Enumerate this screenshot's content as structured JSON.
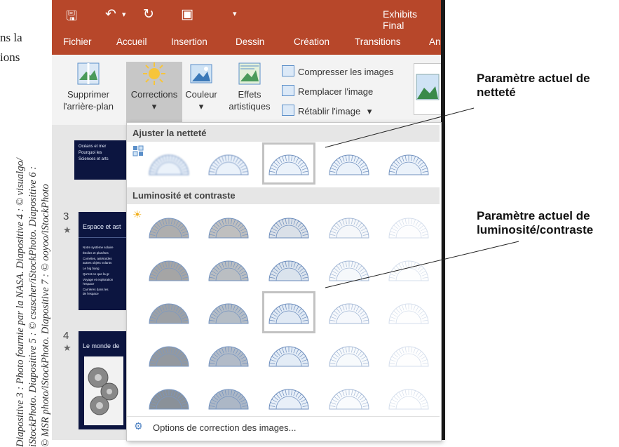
{
  "page": {
    "text_line1": "ns la",
    "text_line2": "ions",
    "credit_line1": "Diapositive 3 : Photo fournie par la NASA. Diapositive 4 : © visualgo/",
    "credit_line2": "iStockPhoto. Diapositive 5 : © csascher/iStockPhoto. Diapositive 6 :",
    "credit_line3": "© MSR photo/iStockPhoto. Diapositive 7 : © ooyoo/iStockPhoto"
  },
  "window": {
    "title": "Exhibits Final",
    "menu": [
      "Fichier",
      "Accueil",
      "Insertion",
      "Dessin",
      "Création",
      "Transitions",
      "Ani"
    ],
    "ribbon": {
      "remove_bg": "Supprimer l'arrière-plan",
      "corrections": "Corrections",
      "couleur": "Couleur",
      "effets": "Effets artistiques",
      "compress": "Compresser les images",
      "replace": "Remplacer l'image",
      "reset": "Rétablir l'image",
      "dropdown_arrow": "▾"
    },
    "slides": [
      {
        "number": "3",
        "star": "★",
        "title": "Espace et ast"
      },
      {
        "number": "4",
        "star": "★",
        "title": "Le monde de"
      }
    ],
    "slide2_bullets": [
      "Océans et mer",
      "Pourquoi les",
      "Sciences et arts"
    ],
    "slide3_bullets": [
      "Notre système solaire",
      "Étoiles et planètes",
      "Comètes, astéroïdes",
      "autres objets volants",
      "Le big bang",
      "Qu'est-ce que la gr",
      "Voyage et exploration",
      "l'espace",
      "Carrières dans les",
      "de l'espace"
    ]
  },
  "gallery": {
    "sharpness_header": "Ajuster la netteté",
    "brightness_header": "Luminosité et contraste",
    "options": "Options de correction des images...",
    "sharpness_levels": [
      -50,
      -25,
      0,
      25,
      50
    ],
    "sharpness_selected_index": 2,
    "brightness_grid_rows": [
      {
        "contrast": "-40%",
        "brightness": [
          "-40%",
          "-20%",
          "0%",
          "+20%",
          "+40%"
        ]
      },
      {
        "contrast": "-20%",
        "brightness": [
          "-40%",
          "-20%",
          "0%",
          "+20%",
          "+40%"
        ]
      },
      {
        "contrast": "0%",
        "brightness": [
          "-40%",
          "-20%",
          "0%",
          "+20%",
          "+40%"
        ]
      },
      {
        "contrast": "+20%",
        "brightness": [
          "-40%",
          "-20%",
          "0%",
          "+20%",
          "+40%"
        ]
      },
      {
        "contrast": "+40%",
        "brightness": [
          "-40%",
          "-20%",
          "0%",
          "+20%",
          "+40%"
        ]
      }
    ],
    "brightness_selected": {
      "row": 2,
      "col": 2
    }
  },
  "callouts": {
    "sharpness": "Paramètre actuel de netteté",
    "brightness": "Paramètre actuel de luminosité/contraste"
  },
  "colors": {
    "accent": "#b7472a",
    "selection_border": "#c2c2c2",
    "protractor": "#5a7fb5"
  }
}
